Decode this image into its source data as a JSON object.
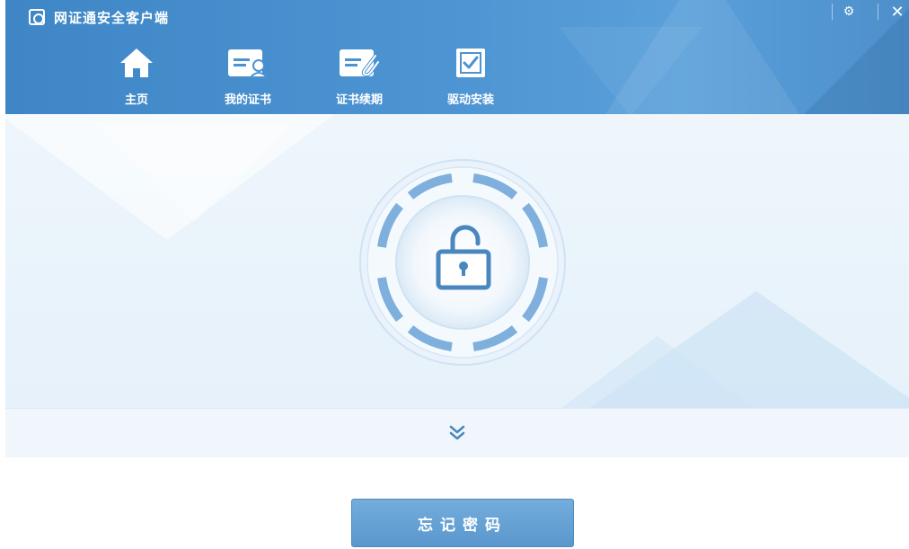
{
  "window": {
    "title": "网证通安全客户端",
    "accent_color": "#4b93d1"
  },
  "controls": {
    "settings_icon": "gear-icon",
    "close_icon": "close-icon",
    "close_glyph": "✕",
    "settings_glyph": "⚙"
  },
  "nav": {
    "items": [
      {
        "label": "主页",
        "icon": "home-icon"
      },
      {
        "label": "我的证书",
        "icon": "certificate-user-icon"
      },
      {
        "label": "证书续期",
        "icon": "certificate-renew-icon"
      },
      {
        "label": "驱动安装",
        "icon": "driver-install-icon"
      }
    ]
  },
  "main": {
    "center_icon": "unlocked-padlock-icon",
    "expand_icon": "double-chevron-down-icon"
  },
  "actions": {
    "forgot_password_label": "忘记密码"
  }
}
